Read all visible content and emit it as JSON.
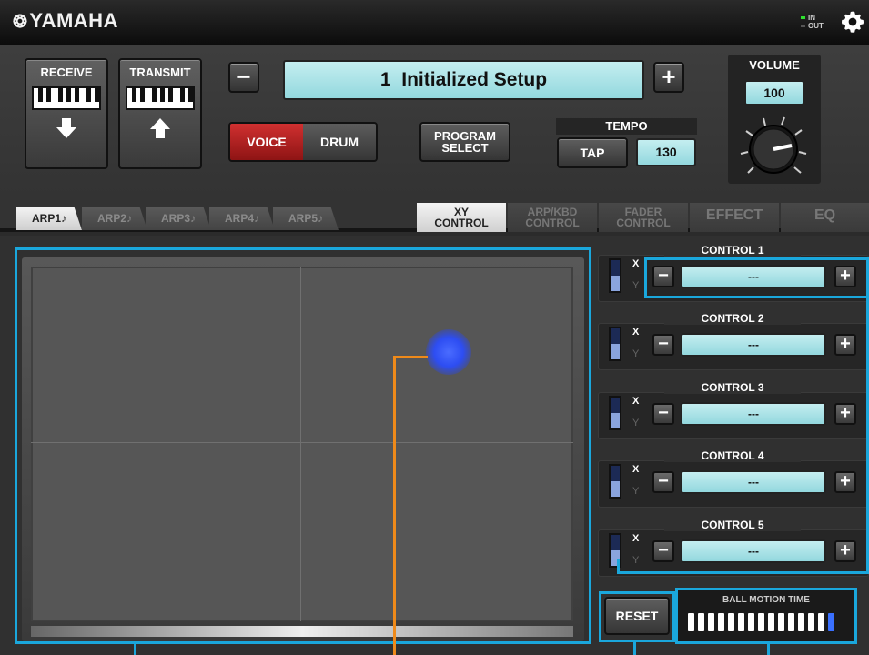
{
  "app": {
    "logo": "YAMAHA",
    "logo_emblem": "❂"
  },
  "status": {
    "in_label": "IN",
    "out_label": "OUT",
    "in_active": true
  },
  "header": {
    "receive_label": "RECEIVE",
    "transmit_label": "TRANSMIT",
    "setup_minus": "−",
    "setup_plus": "+",
    "setup_name": "1  Initialized Setup",
    "voice_label": "VOICE",
    "drum_label": "DRUM",
    "program_select_line1": "PROGRAM",
    "program_select_line2": "SELECT",
    "tempo_label": "TEMPO",
    "tap_label": "TAP",
    "tempo_value": "130",
    "volume_label": "VOLUME",
    "volume_value": "100",
    "active_mode": "VOICE"
  },
  "tabs": {
    "arp": [
      {
        "label": "ARP1♪",
        "selected": true
      },
      {
        "label": "ARP2♪",
        "selected": false
      },
      {
        "label": "ARP3♪",
        "selected": false
      },
      {
        "label": "ARP4♪",
        "selected": false
      },
      {
        "label": "ARP5♪",
        "selected": false
      }
    ],
    "xy_line1": "XY",
    "xy_line2": "CONTROL",
    "arpkbd_line1": "ARP/KBD",
    "arpkbd_line2": "CONTROL",
    "fader_line1": "FADER",
    "fader_line2": "CONTROL",
    "effect": "EFFECT",
    "eq": "EQ",
    "selected_right": "XY CONTROL"
  },
  "controls": [
    {
      "title": "CONTROL 1",
      "x_label": "X",
      "y_label": "Y",
      "value": "---",
      "minus": "−",
      "plus": "+"
    },
    {
      "title": "CONTROL 2",
      "x_label": "X",
      "y_label": "Y",
      "value": "---",
      "minus": "−",
      "plus": "+"
    },
    {
      "title": "CONTROL 3",
      "x_label": "X",
      "y_label": "Y",
      "value": "---",
      "minus": "−",
      "plus": "+"
    },
    {
      "title": "CONTROL 4",
      "x_label": "X",
      "y_label": "Y",
      "value": "---",
      "minus": "−",
      "plus": "+"
    },
    {
      "title": "CONTROL 5",
      "x_label": "X",
      "y_label": "Y",
      "value": "---",
      "minus": "−",
      "plus": "+"
    }
  ],
  "reset_label": "RESET",
  "ball_motion": {
    "label": "BALL MOTION TIME",
    "segments": 15,
    "level": 15
  },
  "colors": {
    "highlight": "#1aa7dc",
    "callout_orange": "#ef8a1a",
    "voice_active": "#c02222",
    "lcd": "#a8e2e6",
    "ball": "#2d4df2"
  }
}
